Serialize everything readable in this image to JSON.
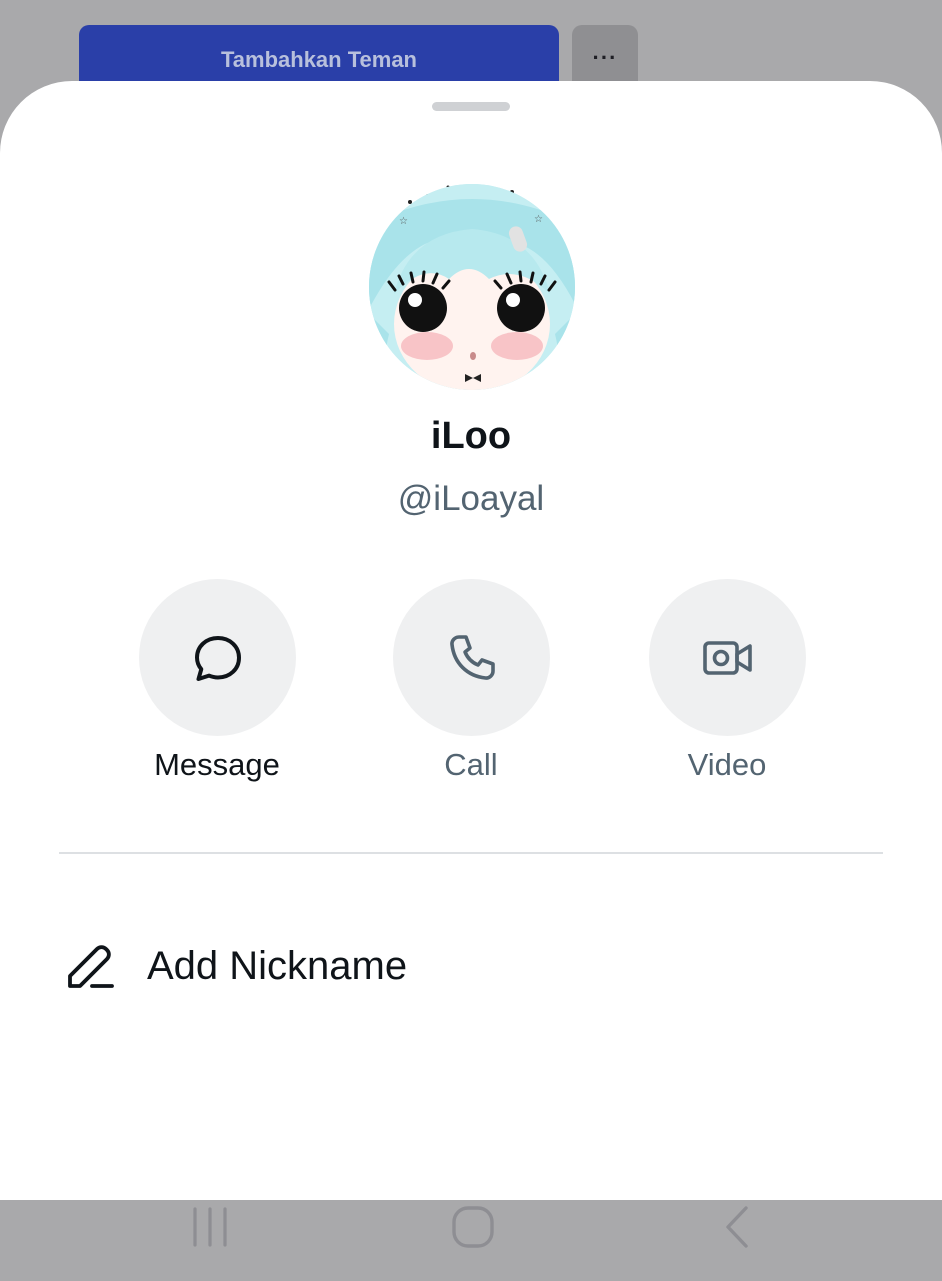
{
  "background_page": {
    "add_friend_label": "Tambahkan Teman",
    "more_label": "···"
  },
  "profile": {
    "display_name": "iLoo",
    "handle": "@iLoayal"
  },
  "actions": {
    "message_label": "Message",
    "call_label": "Call",
    "video_label": "Video"
  },
  "menu": {
    "add_nickname_label": "Add Nickname"
  },
  "colors": {
    "primary_text": "#0f1419",
    "secondary_text": "#536471",
    "action_circle_bg": "#eff0f1",
    "background_button": "#2a3fa8"
  },
  "icons": {
    "message": "chat-bubble-icon",
    "call": "phone-icon",
    "video": "video-camera-icon",
    "nickname": "pencil-icon",
    "nav_recents": "recents-icon",
    "nav_home": "home-icon",
    "nav_back": "back-icon"
  }
}
